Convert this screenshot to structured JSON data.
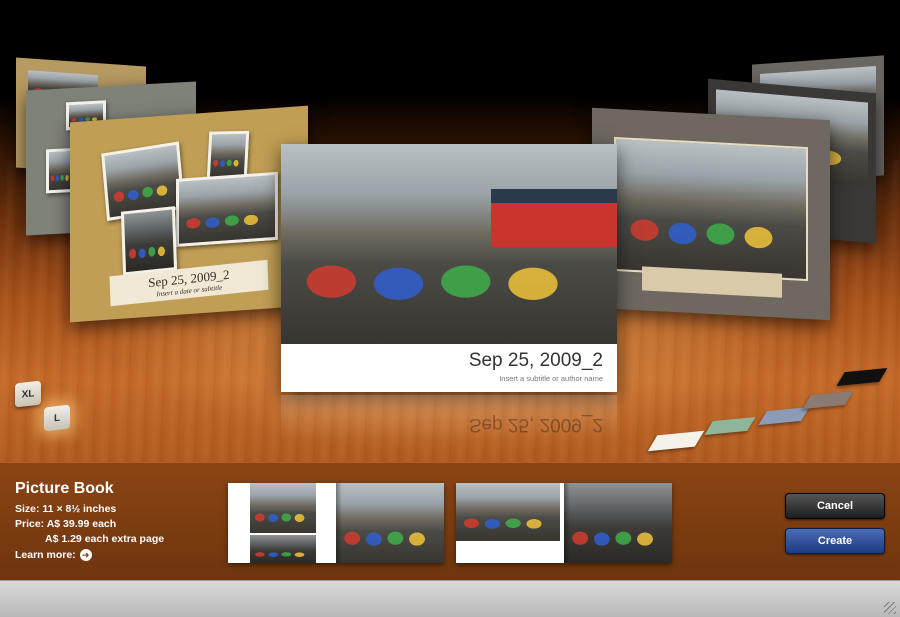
{
  "window": {
    "title": "Picture Book"
  },
  "center_book": {
    "title": "Sep 25, 2009_2",
    "subtitle": "Insert a subtitle or author name",
    "reflection_text": "Sep 25, 2009_2"
  },
  "left_book": {
    "title": "Sep 25, 2009_2",
    "subtitle": "Insert a date or subtitle"
  },
  "size_options": [
    {
      "label": "XL",
      "selected": false
    },
    {
      "label": "L",
      "selected": true
    }
  ],
  "theme_swatches": [
    {
      "color": "#f5f2ea",
      "name": "white-theme"
    },
    {
      "color": "#8fb59a",
      "name": "green-theme"
    },
    {
      "color": "#8b9bb8",
      "name": "blue-theme"
    },
    {
      "color": "#8a7a72",
      "name": "taupe-theme"
    },
    {
      "color": "#101010",
      "name": "black-theme"
    }
  ],
  "product": {
    "name": "Picture Book",
    "size": "Size: 11 × 8½ inches",
    "price": "Price: A$ 39.99 each",
    "extra_page": "A$ 1.29 each extra page",
    "learn_more": "Learn more:"
  },
  "buttons": {
    "cancel": "Cancel",
    "create": "Create"
  },
  "colors": {
    "create_button": "#2a4a95",
    "cancel_button": "#2a2a2a",
    "info_bar": "#7a3b10"
  }
}
